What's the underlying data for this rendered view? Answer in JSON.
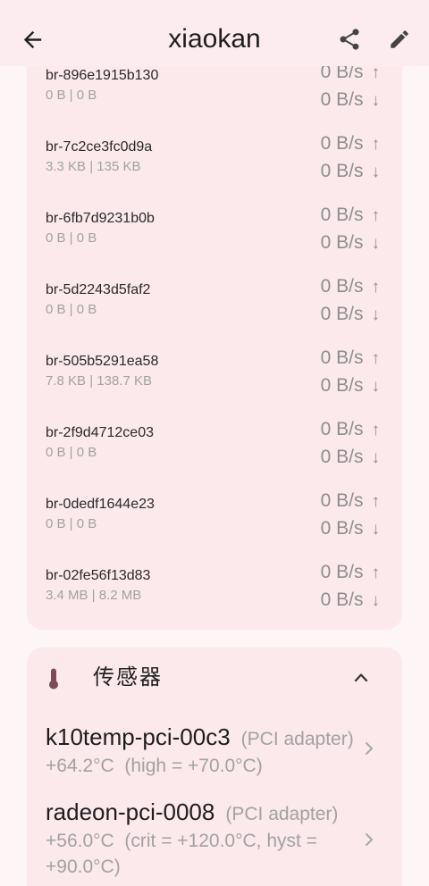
{
  "app_bar": {
    "title": "xiaokan",
    "icons": {
      "back": "arrow-back-icon",
      "share": "share-icon",
      "edit": "edit-pencil-icon"
    }
  },
  "network": {
    "arrows": {
      "up": "↑",
      "down": "↓"
    },
    "interfaces": [
      {
        "name": "br-896e1915b130",
        "total": "0 B | 0 B",
        "upload": "0 B/s",
        "download": "0 B/s"
      },
      {
        "name": "br-7c2ce3fc0d9a",
        "total": "3.3 KB | 135 KB",
        "upload": "0 B/s",
        "download": "0 B/s"
      },
      {
        "name": "br-6fb7d9231b0b",
        "total": "0 B | 0 B",
        "upload": "0 B/s",
        "download": "0 B/s"
      },
      {
        "name": "br-5d2243d5faf2",
        "total": "0 B | 0 B",
        "upload": "0 B/s",
        "download": "0 B/s"
      },
      {
        "name": "br-505b5291ea58",
        "total": "7.8 KB | 138.7 KB",
        "upload": "0 B/s",
        "download": "0 B/s"
      },
      {
        "name": "br-2f9d4712ce03",
        "total": "0 B | 0 B",
        "upload": "0 B/s",
        "download": "0 B/s"
      },
      {
        "name": "br-0dedf1644e23",
        "total": "0 B | 0 B",
        "upload": "0 B/s",
        "download": "0 B/s"
      },
      {
        "name": "br-02fe56f13d83",
        "total": "3.4 MB | 8.2 MB",
        "upload": "0 B/s",
        "download": "0 B/s"
      }
    ]
  },
  "sensors": {
    "title": "传感器",
    "icons": {
      "section": "thermometer-icon",
      "toggle": "chevron-up-icon",
      "item": "chevron-right-icon"
    },
    "items": [
      {
        "name": "k10temp-pci-00c3",
        "adapter": "(PCI adapter)",
        "reading": "+64.2°C  (high = +70.0°C)"
      },
      {
        "name": "radeon-pci-0008",
        "adapter": "(PCI adapter)",
        "reading": "+56.0°C  (crit = +120.0°C, hyst = +90.0°C)"
      }
    ]
  },
  "theme": {
    "page_bg": "#fdf5f6",
    "app_bar_bg": "#fcecef",
    "card_bg": "#fbe9ec",
    "primary_text": "#1f1d1e",
    "secondary_text": "#a2a2a2",
    "speed_text": "#8e8e8e",
    "sensor_icon": "#7d4a58"
  }
}
